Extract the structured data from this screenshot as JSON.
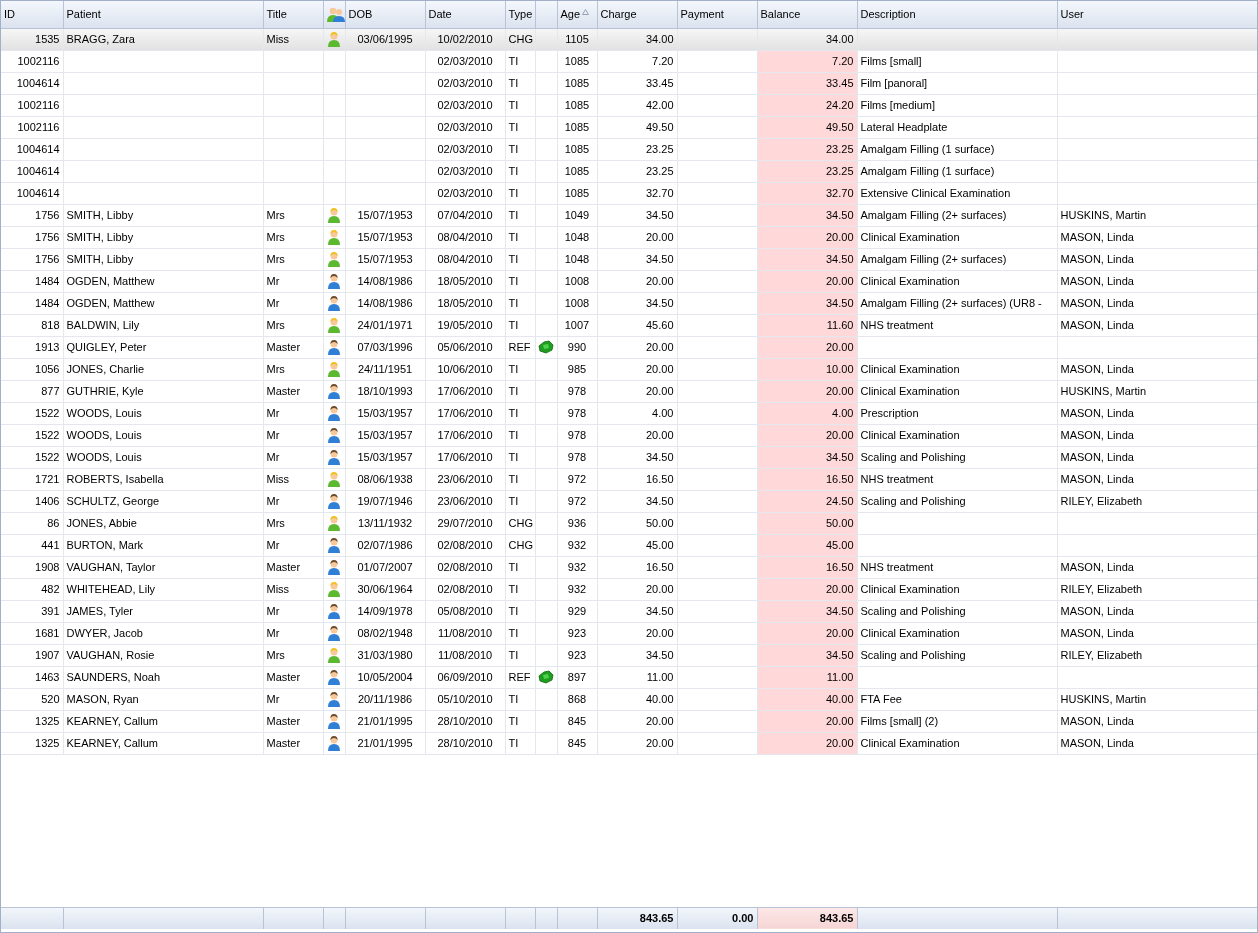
{
  "table": {
    "columns": [
      {
        "label": "ID",
        "kind": "number",
        "sorted": false
      },
      {
        "label": "Patient",
        "kind": "text",
        "sorted": false
      },
      {
        "label": "Title",
        "kind": "text",
        "sorted": false
      },
      {
        "kind": "icon"
      },
      {
        "label": "DOB",
        "kind": "date",
        "sorted": false
      },
      {
        "label": "Date",
        "kind": "date",
        "sorted": false
      },
      {
        "label": "Type",
        "kind": "text",
        "sorted": false
      },
      {
        "kind": "blank"
      },
      {
        "label": "Age",
        "kind": "date",
        "sorted": true
      },
      {
        "label": "Charge",
        "kind": "number",
        "sorted": false
      },
      {
        "label": "Payment",
        "kind": "number",
        "sorted": false
      },
      {
        "label": "Balance",
        "kind": "number",
        "sorted": false
      },
      {
        "label": "Description",
        "kind": "text",
        "sorted": false
      },
      {
        "label": "User",
        "kind": "text",
        "sorted": false
      }
    ],
    "rows": [
      {
        "selected": true,
        "id": "1535",
        "patient": "BRAGG, Zara",
        "title": "Miss",
        "kind": "female",
        "dob": "03/06/1995",
        "date": "10/02/2010",
        "type": "CHG",
        "age": "1105",
        "charge": "34.00",
        "balance": "34.00"
      },
      {
        "selected": false,
        "id": "1002116",
        "date": "02/03/2010",
        "type": "TI",
        "age": "1085",
        "charge": "7.20",
        "balance": "7.20",
        "description": "Films [small]"
      },
      {
        "selected": false,
        "id": "1004614",
        "date": "02/03/2010",
        "type": "TI",
        "age": "1085",
        "charge": "33.45",
        "balance": "33.45",
        "description": "Film [panoral]"
      },
      {
        "selected": false,
        "id": "1002116",
        "date": "02/03/2010",
        "type": "TI",
        "age": "1085",
        "charge": "42.00",
        "balance": "24.20",
        "description": "Films [medium]"
      },
      {
        "selected": false,
        "id": "1002116",
        "date": "02/03/2010",
        "type": "TI",
        "age": "1085",
        "charge": "49.50",
        "balance": "49.50",
        "description": "Lateral Headplate"
      },
      {
        "selected": false,
        "id": "1004614",
        "date": "02/03/2010",
        "type": "TI",
        "age": "1085",
        "charge": "23.25",
        "balance": "23.25",
        "description": "Amalgam Filling (1 surface)"
      },
      {
        "selected": false,
        "id": "1004614",
        "date": "02/03/2010",
        "type": "TI",
        "age": "1085",
        "charge": "23.25",
        "balance": "23.25",
        "description": "Amalgam Filling (1 surface)"
      },
      {
        "selected": false,
        "id": "1004614",
        "date": "02/03/2010",
        "type": "TI",
        "age": "1085",
        "charge": "32.70",
        "balance": "32.70",
        "description": "Extensive Clinical Examination"
      },
      {
        "selected": false,
        "id": "1756",
        "patient": "SMITH, Libby",
        "title": "Mrs",
        "kind": "female",
        "dob": "15/07/1953",
        "date": "07/04/2010",
        "type": "TI",
        "age": "1049",
        "charge": "34.50",
        "balance": "34.50",
        "description": "Amalgam Filling (2+ surfaces)",
        "user": "HUSKINS, Martin"
      },
      {
        "selected": false,
        "id": "1756",
        "patient": "SMITH, Libby",
        "title": "Mrs",
        "kind": "female",
        "dob": "15/07/1953",
        "date": "08/04/2010",
        "type": "TI",
        "age": "1048",
        "charge": "20.00",
        "balance": "20.00",
        "description": "Clinical Examination",
        "user": "MASON, Linda"
      },
      {
        "selected": false,
        "id": "1756",
        "patient": "SMITH, Libby",
        "title": "Mrs",
        "kind": "female",
        "dob": "15/07/1953",
        "date": "08/04/2010",
        "type": "TI",
        "age": "1048",
        "charge": "34.50",
        "balance": "34.50",
        "description": "Amalgam Filling (2+ surfaces)",
        "user": "MASON, Linda"
      },
      {
        "selected": false,
        "id": "1484",
        "patient": "OGDEN, Matthew",
        "title": "Mr",
        "kind": "male",
        "dob": "14/08/1986",
        "date": "18/05/2010",
        "type": "TI",
        "age": "1008",
        "charge": "20.00",
        "balance": "20.00",
        "description": "Clinical Examination",
        "user": "MASON, Linda"
      },
      {
        "selected": false,
        "id": "1484",
        "patient": "OGDEN, Matthew",
        "title": "Mr",
        "kind": "male",
        "dob": "14/08/1986",
        "date": "18/05/2010",
        "type": "TI",
        "age": "1008",
        "charge": "34.50",
        "balance": "34.50",
        "description": "Amalgam Filling (2+ surfaces) (UR8 -",
        "user": "MASON, Linda"
      },
      {
        "selected": false,
        "id": "818",
        "patient": "BALDWIN, Lily",
        "title": "Mrs",
        "kind": "female",
        "dob": "24/01/1971",
        "date": "19/05/2010",
        "type": "TI",
        "age": "1007",
        "charge": "45.60",
        "balance": "11.60",
        "description": "NHS treatment",
        "user": "MASON, Linda"
      },
      {
        "selected": false,
        "id": "1913",
        "patient": "QUIGLEY, Peter",
        "title": "Master",
        "kind": "male",
        "dob": "07/03/1996",
        "date": "05/06/2010",
        "type": "REF",
        "ref": true,
        "age": "990",
        "charge": "20.00",
        "balance": "20.00"
      },
      {
        "selected": false,
        "id": "1056",
        "patient": "JONES, Charlie",
        "title": "Mrs",
        "kind": "female",
        "dob": "24/11/1951",
        "date": "10/06/2010",
        "type": "TI",
        "age": "985",
        "charge": "20.00",
        "balance": "10.00",
        "description": "Clinical Examination",
        "user": "MASON, Linda"
      },
      {
        "selected": false,
        "id": "877",
        "patient": "GUTHRIE, Kyle",
        "title": "Master",
        "kind": "male",
        "dob": "18/10/1993",
        "date": "17/06/2010",
        "type": "TI",
        "age": "978",
        "charge": "20.00",
        "balance": "20.00",
        "description": "Clinical Examination",
        "user": "HUSKINS, Martin"
      },
      {
        "selected": false,
        "id": "1522",
        "patient": "WOODS, Louis",
        "title": "Mr",
        "kind": "male",
        "dob": "15/03/1957",
        "date": "17/06/2010",
        "type": "TI",
        "age": "978",
        "charge": "4.00",
        "balance": "4.00",
        "description": "Prescription",
        "user": "MASON, Linda"
      },
      {
        "selected": false,
        "id": "1522",
        "patient": "WOODS, Louis",
        "title": "Mr",
        "kind": "male",
        "dob": "15/03/1957",
        "date": "17/06/2010",
        "type": "TI",
        "age": "978",
        "charge": "20.00",
        "balance": "20.00",
        "description": "Clinical Examination",
        "user": "MASON, Linda"
      },
      {
        "selected": false,
        "id": "1522",
        "patient": "WOODS, Louis",
        "title": "Mr",
        "kind": "male",
        "dob": "15/03/1957",
        "date": "17/06/2010",
        "type": "TI",
        "age": "978",
        "charge": "34.50",
        "balance": "34.50",
        "description": "Scaling and Polishing",
        "user": "MASON, Linda"
      },
      {
        "selected": false,
        "id": "1721",
        "patient": "ROBERTS, Isabella",
        "title": "Miss",
        "kind": "female",
        "dob": "08/06/1938",
        "date": "23/06/2010",
        "type": "TI",
        "age": "972",
        "charge": "16.50",
        "balance": "16.50",
        "description": "NHS treatment",
        "user": "MASON, Linda"
      },
      {
        "selected": false,
        "id": "1406",
        "patient": "SCHULTZ, George",
        "title": "Mr",
        "kind": "male",
        "dob": "19/07/1946",
        "date": "23/06/2010",
        "type": "TI",
        "age": "972",
        "charge": "34.50",
        "balance": "24.50",
        "description": "Scaling and Polishing",
        "user": "RILEY, Elizabeth"
      },
      {
        "selected": false,
        "id": "86",
        "patient": "JONES, Abbie",
        "title": "Mrs",
        "kind": "female",
        "dob": "13/11/1932",
        "date": "29/07/2010",
        "type": "CHG",
        "age": "936",
        "charge": "50.00",
        "balance": "50.00"
      },
      {
        "selected": false,
        "id": "441",
        "patient": "BURTON, Mark",
        "title": "Mr",
        "kind": "male",
        "dob": "02/07/1986",
        "date": "02/08/2010",
        "type": "CHG",
        "age": "932",
        "charge": "45.00",
        "balance": "45.00"
      },
      {
        "selected": false,
        "id": "1908",
        "patient": "VAUGHAN, Taylor",
        "title": "Master",
        "kind": "male",
        "dob": "01/07/2007",
        "date": "02/08/2010",
        "type": "TI",
        "age": "932",
        "charge": "16.50",
        "balance": "16.50",
        "description": "NHS treatment",
        "user": "MASON, Linda"
      },
      {
        "selected": false,
        "id": "482",
        "patient": "WHITEHEAD, Lily",
        "title": "Miss",
        "kind": "female",
        "dob": "30/06/1964",
        "date": "02/08/2010",
        "type": "TI",
        "age": "932",
        "charge": "20.00",
        "balance": "20.00",
        "description": "Clinical Examination",
        "user": "RILEY, Elizabeth"
      },
      {
        "selected": false,
        "id": "391",
        "patient": "JAMES, Tyler",
        "title": "Mr",
        "kind": "male",
        "dob": "14/09/1978",
        "date": "05/08/2010",
        "type": "TI",
        "age": "929",
        "charge": "34.50",
        "balance": "34.50",
        "description": "Scaling and Polishing",
        "user": "MASON, Linda"
      },
      {
        "selected": false,
        "id": "1681",
        "patient": "DWYER, Jacob",
        "title": "Mr",
        "kind": "male",
        "dob": "08/02/1948",
        "date": "11/08/2010",
        "type": "TI",
        "age": "923",
        "charge": "20.00",
        "balance": "20.00",
        "description": "Clinical Examination",
        "user": "MASON, Linda"
      },
      {
        "selected": false,
        "id": "1907",
        "patient": "VAUGHAN, Rosie",
        "title": "Mrs",
        "kind": "female",
        "dob": "31/03/1980",
        "date": "11/08/2010",
        "type": "TI",
        "age": "923",
        "charge": "34.50",
        "balance": "34.50",
        "description": "Scaling and Polishing",
        "user": "RILEY, Elizabeth"
      },
      {
        "selected": false,
        "id": "1463",
        "patient": "SAUNDERS, Noah",
        "title": "Master",
        "kind": "male",
        "dob": "10/05/2004",
        "date": "06/09/2010",
        "type": "REF",
        "ref": true,
        "age": "897",
        "charge": "11.00",
        "balance": "11.00"
      },
      {
        "selected": false,
        "id": "520",
        "patient": "MASON, Ryan",
        "title": "Mr",
        "kind": "male",
        "dob": "20/11/1986",
        "date": "05/10/2010",
        "type": "TI",
        "age": "868",
        "charge": "40.00",
        "balance": "40.00",
        "description": "FTA Fee",
        "user": "HUSKINS, Martin"
      },
      {
        "selected": false,
        "id": "1325",
        "patient": "KEARNEY, Callum",
        "title": "Master",
        "kind": "male",
        "dob": "21/01/1995",
        "date": "28/10/2010",
        "type": "TI",
        "age": "845",
        "charge": "20.00",
        "balance": "20.00",
        "description": "Films [small] (2)",
        "user": "MASON, Linda"
      },
      {
        "selected": false,
        "id": "1325",
        "patient": "KEARNEY, Callum",
        "title": "Master",
        "kind": "male",
        "dob": "21/01/1995",
        "date": "28/10/2010",
        "type": "TI",
        "age": "845",
        "charge": "20.00",
        "balance": "20.00",
        "description": "Clinical Examination",
        "user": "MASON, Linda"
      }
    ],
    "totals": {
      "charge": "843.65",
      "payment": "0.00",
      "balance": "843.65"
    }
  }
}
